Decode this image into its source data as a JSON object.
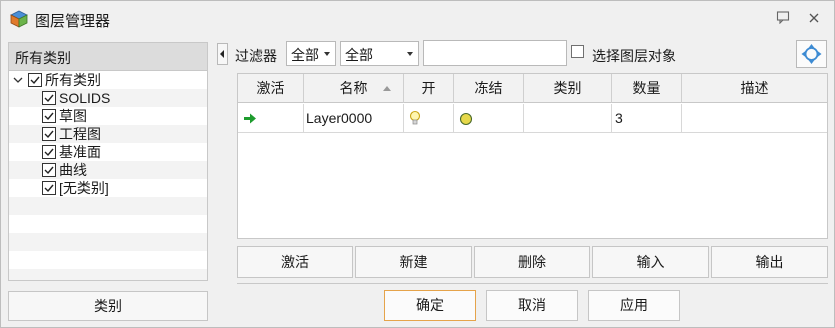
{
  "window": {
    "title": "图层管理器",
    "icons": {
      "app": "layer-manager-icon",
      "help": "message-icon",
      "close": "close-icon"
    }
  },
  "left_panel": {
    "header": "所有类别",
    "tree": {
      "root": {
        "label": "所有类别",
        "checked": true,
        "expanded": true
      },
      "children": [
        {
          "label": "SOLIDS",
          "checked": true
        },
        {
          "label": "草图",
          "checked": true
        },
        {
          "label": "工程图",
          "checked": true
        },
        {
          "label": "基准面",
          "checked": true
        },
        {
          "label": "曲线",
          "checked": true
        },
        {
          "label": "[无类别]",
          "checked": true
        }
      ]
    },
    "category_button": "类别"
  },
  "filter": {
    "label": "过滤器",
    "scope_value": "全部",
    "type_value": "全部",
    "search_value": "",
    "select_label": "选择图层对象",
    "select_checked": false
  },
  "table": {
    "columns": [
      "激活",
      "名称",
      "开",
      "冻结",
      "类别",
      "数量",
      "描述"
    ],
    "sorted_column": "名称",
    "rows": [
      {
        "active": true,
        "name": "Layer0000",
        "on": true,
        "frozen": false,
        "category": "",
        "count": "3",
        "description": ""
      }
    ]
  },
  "actions": [
    "激活",
    "新建",
    "删除",
    "输入",
    "输出"
  ],
  "dialog_buttons": {
    "ok": "确定",
    "cancel": "取消",
    "apply": "应用"
  },
  "colors": {
    "active_arrow": "#1e9c2e",
    "bulb": "#e3c62a",
    "frozen_dot": "#e6d84a",
    "accent_border": "#e5a34a",
    "refresh_icon": "#3d8bd3"
  }
}
